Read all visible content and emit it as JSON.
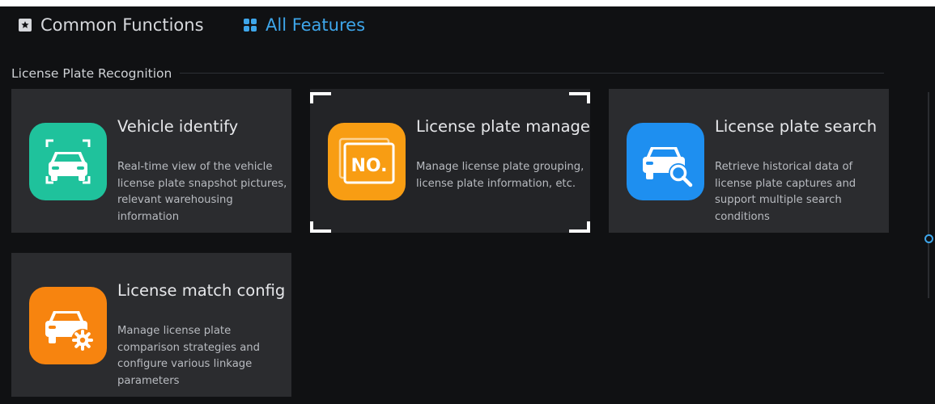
{
  "tabs": {
    "common": {
      "label": "Common Functions",
      "icon": "star-box-icon"
    },
    "all": {
      "label": "All Features",
      "icon": "grid-icon",
      "active": true
    }
  },
  "section": {
    "title": "License Plate Recognition"
  },
  "cards": [
    {
      "title": "Vehicle identify",
      "description": "Real-time view of the vehicle license plate snapshot pictures, relevant warehousing information",
      "icon": "vehicle-identify-icon",
      "color": "#1fc29c"
    },
    {
      "title": "License plate manage",
      "description": "Manage license plate grouping, license plate information, etc.",
      "icon": "license-plate-no-icon",
      "color": "#f89d13",
      "selected": true,
      "icon_text": "NO."
    },
    {
      "title": "License plate search",
      "description": "Retrieve historical data of license plate captures and support multiple search conditions",
      "icon": "license-plate-search-icon",
      "color": "#1e8ff0"
    },
    {
      "title": "License match config",
      "description": "Manage license plate comparison strategies and configure various linkage parameters",
      "icon": "license-match-config-icon",
      "color": "#f7840f"
    }
  ],
  "colors": {
    "background": "#101113",
    "card": "#2b2c2f",
    "accent": "#3ea6ea",
    "text": "#e6e7ea"
  }
}
